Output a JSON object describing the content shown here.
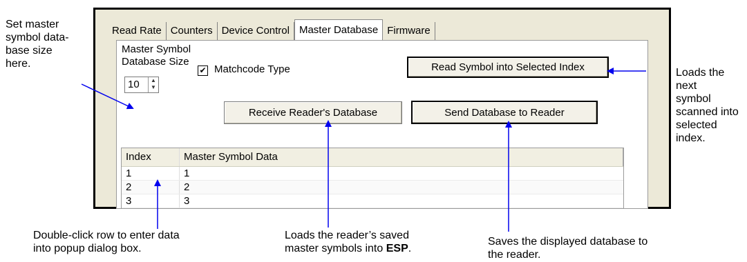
{
  "tabs": [
    "Read Rate",
    "Counters",
    "Device Control",
    "Master Database",
    "Firmware"
  ],
  "active_tab": "Master Database",
  "panel": {
    "size_label_line1": "Master Symbol",
    "size_label_line2": "Database Size",
    "size_value": "10",
    "matchcode_label": "Matchcode Type",
    "matchcode_checked": "✔",
    "read_symbol_button": "Read Symbol into Selected Index",
    "receive_button": "Receive Reader's Database",
    "send_button": "Send Database to Reader"
  },
  "table": {
    "headers": [
      "Index",
      "Master Symbol Data"
    ],
    "rows": [
      [
        "1",
        "1"
      ],
      [
        "2",
        "2"
      ],
      [
        "3",
        "3"
      ]
    ]
  },
  "annotations": {
    "left_top": [
      "Set master",
      "symbol data-",
      "base size",
      "here."
    ],
    "right_top": [
      "Loads the next",
      "symbol",
      "scanned into",
      "selected index."
    ],
    "bottom_left": [
      "Double-click row to enter data",
      "into popup dialog box."
    ],
    "bottom_mid_line1": "Loads the reader’s saved",
    "bottom_mid_line2_prefix": "master symbols into ",
    "bottom_mid_bold": "ESP",
    "bottom_mid_suffix": ".",
    "bottom_right": [
      "Saves the displayed database to",
      "the reader."
    ]
  },
  "colors": {
    "arrow": "#0000ee",
    "window_bg": "#ece9d8"
  }
}
